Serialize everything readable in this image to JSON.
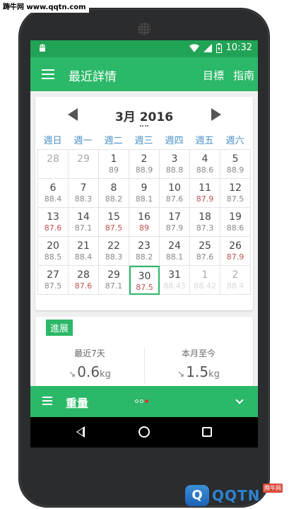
{
  "watermark": {
    "top": "踌牛网 www.qqtn.com",
    "bottom_badge": "Q",
    "bottom_text": "QQTN",
    "bottom_tag": "腾牛网"
  },
  "statusbar": {
    "time": "10:32"
  },
  "appbar": {
    "title": "最近詳情",
    "action_goals": "目標",
    "action_guide": "指南"
  },
  "calendar": {
    "month_label": "3月 2016",
    "weekdays": [
      "週日",
      "週一",
      "週二",
      "週三",
      "週四",
      "週五",
      "週六"
    ],
    "weeks": [
      [
        {
          "day": "28",
          "weight": "",
          "type": "other"
        },
        {
          "day": "29",
          "weight": "",
          "type": "other"
        },
        {
          "day": "1",
          "weight": "89",
          "type": "normal"
        },
        {
          "day": "2",
          "weight": "88.9",
          "type": "normal"
        },
        {
          "day": "3",
          "weight": "88.8",
          "type": "normal"
        },
        {
          "day": "4",
          "weight": "88.6",
          "type": "normal"
        },
        {
          "day": "5",
          "weight": "88.9",
          "type": "normal"
        }
      ],
      [
        {
          "day": "6",
          "weight": "88.4",
          "type": "normal"
        },
        {
          "day": "7",
          "weight": "88.3",
          "type": "normal"
        },
        {
          "day": "8",
          "weight": "88.2",
          "type": "normal"
        },
        {
          "day": "9",
          "weight": "88.1",
          "type": "normal"
        },
        {
          "day": "10",
          "weight": "87.6",
          "type": "normal"
        },
        {
          "day": "11",
          "weight": "87.9",
          "type": "hi"
        },
        {
          "day": "12",
          "weight": "87.5",
          "type": "normal"
        }
      ],
      [
        {
          "day": "13",
          "weight": "87.6",
          "type": "hi"
        },
        {
          "day": "14",
          "weight": "87.1",
          "type": "normal"
        },
        {
          "day": "15",
          "weight": "87.5",
          "type": "hi"
        },
        {
          "day": "16",
          "weight": "89",
          "type": "hi"
        },
        {
          "day": "17",
          "weight": "87.9",
          "type": "normal"
        },
        {
          "day": "18",
          "weight": "87.3",
          "type": "normal"
        },
        {
          "day": "19",
          "weight": "88.6",
          "type": "normal"
        }
      ],
      [
        {
          "day": "20",
          "weight": "88.5",
          "type": "normal"
        },
        {
          "day": "21",
          "weight": "88.4",
          "type": "normal"
        },
        {
          "day": "22",
          "weight": "88.3",
          "type": "normal"
        },
        {
          "day": "23",
          "weight": "88.2",
          "type": "normal"
        },
        {
          "day": "24",
          "weight": "88.1",
          "type": "normal"
        },
        {
          "day": "25",
          "weight": "87.6",
          "type": "normal"
        },
        {
          "day": "26",
          "weight": "87.9",
          "type": "hi"
        }
      ],
      [
        {
          "day": "27",
          "weight": "87.5",
          "type": "normal"
        },
        {
          "day": "28",
          "weight": "87.6",
          "type": "hi"
        },
        {
          "day": "29",
          "weight": "87.1",
          "type": "normal"
        },
        {
          "day": "30",
          "weight": "87.5",
          "type": "today"
        },
        {
          "day": "31",
          "weight": "88.43",
          "type": "future"
        },
        {
          "day": "1",
          "weight": "88.42",
          "type": "other-future"
        },
        {
          "day": "2",
          "weight": "88.4",
          "type": "other-future"
        }
      ]
    ]
  },
  "progress": {
    "badge": "進展",
    "stats": [
      {
        "label": "最近7天",
        "trend": "↘",
        "value": "0.6",
        "unit": "kg"
      },
      {
        "label": "本月至今",
        "trend": "↘",
        "value": "1.5",
        "unit": "kg"
      }
    ]
  },
  "bottombar": {
    "label": "重量"
  },
  "colors": {
    "primary": "#2bb868",
    "primary_dark": "#21a356",
    "highlight_weight": "#c0504d",
    "weekday_blue": "#4a90c8"
  }
}
